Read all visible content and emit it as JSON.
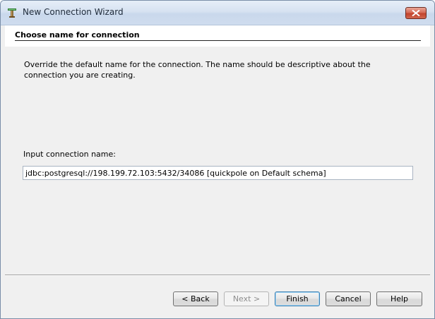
{
  "window": {
    "title": "New Connection Wizard",
    "app_icon": "wizard-icon",
    "close_icon": "close-icon"
  },
  "header": {
    "title": "Choose name for connection"
  },
  "main": {
    "description": "Override the default name for the connection. The name should be descriptive about the connection you are creating.",
    "input_label": "Input connection name:",
    "input_value": "jdbc:postgresql://198.199.72.103:5432/34086 [quickpole on Default schema]"
  },
  "buttons": {
    "back": "< Back",
    "next": "Next >",
    "finish": "Finish",
    "cancel": "Cancel",
    "help": "Help"
  },
  "colors": {
    "titlebar": "#d6e2f1",
    "close_button": "#c2432d",
    "dialog_background": "#f0f0f0",
    "default_button_border": "#3c7fb1"
  }
}
